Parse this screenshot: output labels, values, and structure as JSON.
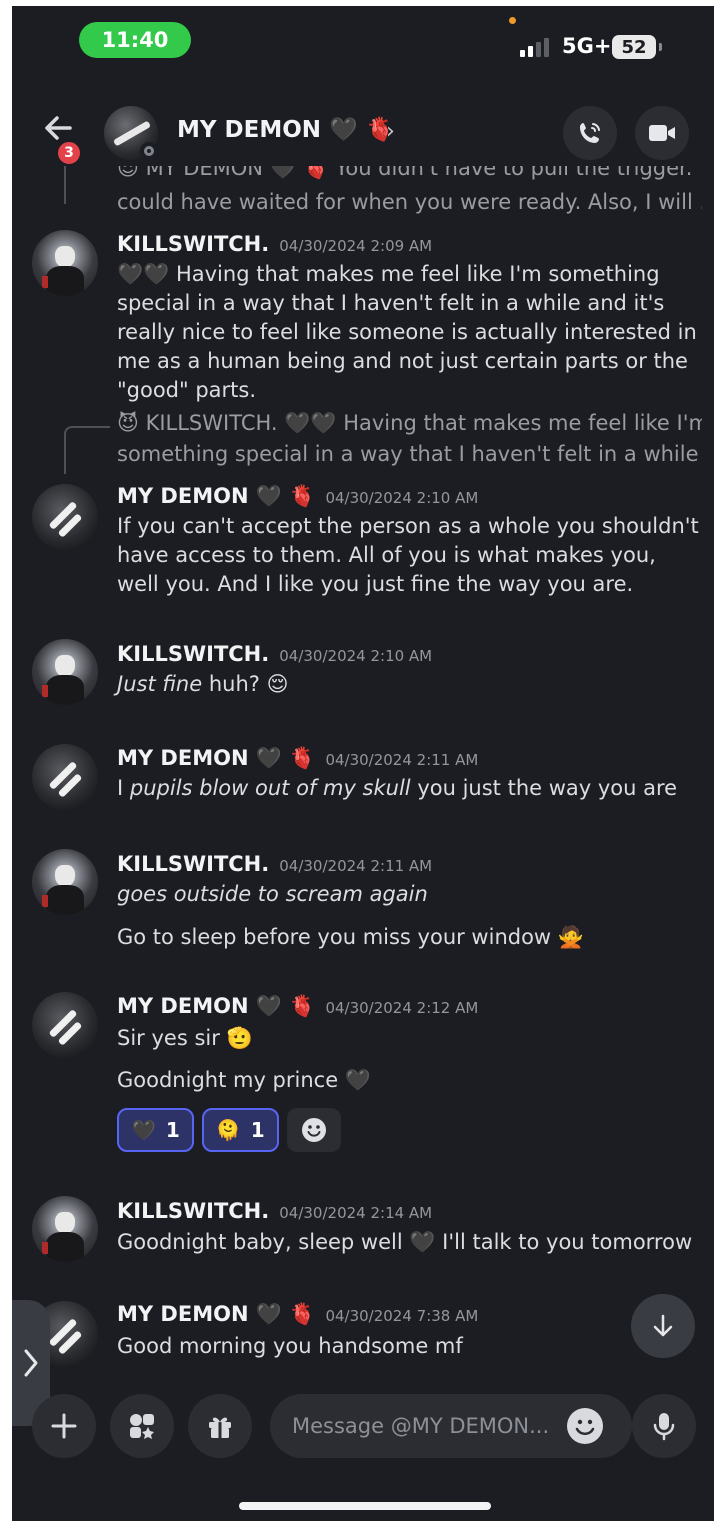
{
  "status_bar": {
    "time": "11:40",
    "network": "5G+",
    "battery": "52"
  },
  "header": {
    "back_badge": "3",
    "title": "MY DEMON 🖤 🫀",
    "chevron": "›"
  },
  "messages": [
    {
      "reply_preview_line1": "😈 MY DEMON 🖤 🫀 You didn't have to pull the trigger. You",
      "reply_preview_line2": "could have waited for when you were ready. Also, I will ...",
      "author": "KILLSWITCH.",
      "time": "04/30/2024 2:09 AM",
      "text": "🖤🖤 Having that makes me feel like I'm something special in a way that I haven't felt in a while and it's really nice to feel like someone is actually interested in me as a human being and not just certain parts or the \"good\" parts."
    },
    {
      "reply_preview_line1": "😈 KILLSWITCH. 🖤🖤 Having that makes me feel like I'm",
      "reply_preview_line2": "something special in a way that I haven't felt in a while an...",
      "author": "MY DEMON 🖤 🫀",
      "time": "04/30/2024 2:10 AM",
      "text": "If you can't accept the person as a whole you shouldn't have access to them. All of you is what makes you, well you. And I like you just fine the way you are."
    },
    {
      "author": "KILLSWITCH.",
      "time": "04/30/2024 2:10 AM",
      "text_italic": "Just fine",
      "text_rest": "huh? 😌"
    },
    {
      "author": "MY DEMON 🖤 🫀",
      "time": "04/30/2024 2:11 AM",
      "text_before": "I",
      "text_italic": "pupils blow out of my skull",
      "text_after": "you just the way you are"
    },
    {
      "author": "KILLSWITCH.",
      "time": "04/30/2024 2:11 AM",
      "text_italic": "goes outside to scream again",
      "text2": "Go to sleep before you miss your window 🙅"
    },
    {
      "author": "MY DEMON 🖤 🫀",
      "time": "04/30/2024 2:12 AM",
      "text": "Sir yes sir 🫡",
      "text2": "Goodnight my prince 🖤",
      "reactions": [
        {
          "emoji": "🖤",
          "count": "1"
        },
        {
          "emoji": "🫠",
          "count": "1"
        }
      ]
    },
    {
      "author": "KILLSWITCH.",
      "time": "04/30/2024 2:14 AM",
      "text": "Goodnight baby, sleep well 🖤 I'll talk to you tomorrow"
    },
    {
      "author": "MY DEMON 🖤 🫀",
      "time": "04/30/2024 7:38 AM",
      "text": "Good morning you handsome mf"
    }
  ],
  "composer": {
    "placeholder": "Message @MY DEMON..."
  },
  "icons": {
    "back": "arrow-left-icon",
    "call": "phone-icon",
    "video": "video-camera-icon",
    "attach": "plus-icon",
    "apps": "apps-icon",
    "gift": "gift-icon",
    "emoji": "smile-icon",
    "mic": "microphone-icon",
    "scroll": "arrow-down-icon"
  },
  "colors": {
    "background": "#1c1d22",
    "accent": "#5865f2",
    "badge": "#e2424a",
    "time_pill": "#33c94a"
  }
}
